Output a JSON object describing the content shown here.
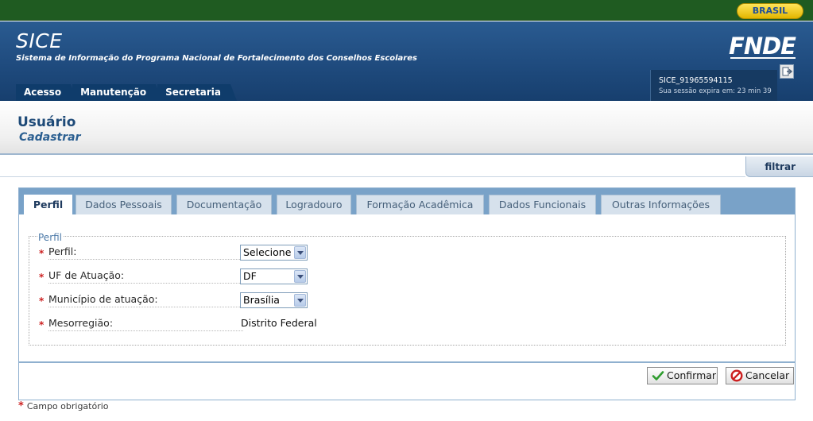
{
  "gov_bar": {
    "badge": "BRASIL"
  },
  "header": {
    "title": "SICE",
    "subtitle": "Sistema de Informação do Programa Nacional de Fortalecimento dos Conselhos Escolares",
    "logo": "FNDE",
    "menu": [
      "Acesso",
      "Manutenção",
      "Secretaria"
    ],
    "session": {
      "user": "SICE_91965594115",
      "expires": "Sua sessão expira em: 23 min 39"
    }
  },
  "page": {
    "title": "Usuário",
    "subtitle": "Cadastrar",
    "filter_label": "filtrar"
  },
  "tabs": [
    "Perfil",
    "Dados Pessoais",
    "Documentação",
    "Logradouro",
    "Formação Acadêmica",
    "Dados Funcionais",
    "Outras Informações"
  ],
  "form": {
    "legend": "Perfil",
    "required_mark": "*",
    "fields": {
      "perfil": {
        "label": "Perfil:",
        "value": "Selecione"
      },
      "uf": {
        "label": "UF de Atuação:",
        "value": "DF"
      },
      "municipio": {
        "label": "Município de atuação:",
        "value": "Brasília"
      },
      "mesorregiao": {
        "label": "Mesorregião:",
        "value": "Distrito Federal"
      }
    }
  },
  "buttons": {
    "confirm": "Confirmar",
    "cancel": "Cancelar"
  },
  "footnote": {
    "star": "*",
    "text": "Campo obrigatório"
  },
  "colors": {
    "gov_green": "#1f5b21",
    "header_blue": "#1f4b7e",
    "tabbar_blue": "#79a2c8",
    "required_red": "#cc1f1f"
  }
}
